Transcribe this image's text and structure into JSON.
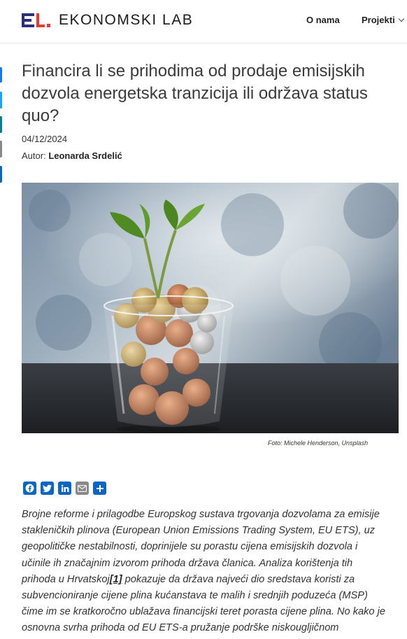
{
  "header": {
    "logo_text": "EKONOMSKI LAB",
    "nav": [
      {
        "label": "O nama"
      },
      {
        "label": "Projekti"
      }
    ]
  },
  "article": {
    "title": "Financira li se prihodima od prodaje emisijskih dozvola energetska tranzicija ili održava status quo?",
    "date": "04/12/2024",
    "author_prefix": "Autor:",
    "author_name": "Leonarda Srdelić",
    "image_caption": "Foto: Michele Henderson, Unsplash",
    "paragraph_part1": "Brojne reforme i prilagodbe Europskog sustava trgovanja dozvolama za emisije stakleničkih plinova (European Union Emissions Trading System, EU ETS), uz geopolitičke nestabilnosti, doprinijele su porastu cijena emisijskih dozvola i učinile ih značajnim izvorom prihoda država članica. Analiza korištenja tih prihoda u Hrvatskoj",
    "footnote_ref": "[1]",
    "paragraph_part2": " pokazuje da država najveći dio sredstava koristi za subvencioniranje cijene plina kućanstava te malih i srednjih poduzeća (MSP) čime im se kratkoročno ublažava financijski teret porasta cijene plina. No kako je osnovna svrha prihoda od EU ETS-a pružanje podrške niskougljičnom gospodarstvu, sredstva bi od subvencioniranja plina kućanstvima i MSP-ima"
  },
  "share_icons": [
    "facebook-icon",
    "twitter-icon",
    "linkedin-icon",
    "email-icon",
    "share-plus-icon"
  ],
  "colors": {
    "brand_blue": "#2b2f7a",
    "brand_red": "#e63a2e",
    "share_blue": "#0b66c3"
  }
}
